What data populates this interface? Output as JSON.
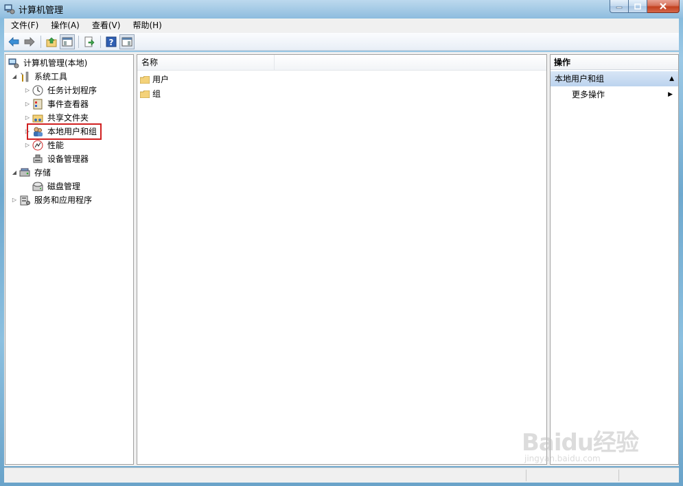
{
  "window": {
    "title": "计算机管理"
  },
  "menu": [
    "文件(F)",
    "操作(A)",
    "查看(V)",
    "帮助(H)"
  ],
  "tree": {
    "root": "计算机管理(本地)",
    "system_tools": "系统工具",
    "task_scheduler": "任务计划程序",
    "event_viewer": "事件查看器",
    "shared_folders": "共享文件夹",
    "local_users_groups": "本地用户和组",
    "performance": "性能",
    "device_manager": "设备管理器",
    "storage": "存储",
    "disk_management": "磁盘管理",
    "services_apps": "服务和应用程序"
  },
  "list": {
    "column_name": "名称",
    "items": [
      "用户",
      "组"
    ]
  },
  "actions": {
    "header": "操作",
    "section": "本地用户和组",
    "more_actions": "更多操作"
  },
  "watermark": {
    "main": "Baidu经验",
    "sub": "jingyan.baidu.com"
  }
}
